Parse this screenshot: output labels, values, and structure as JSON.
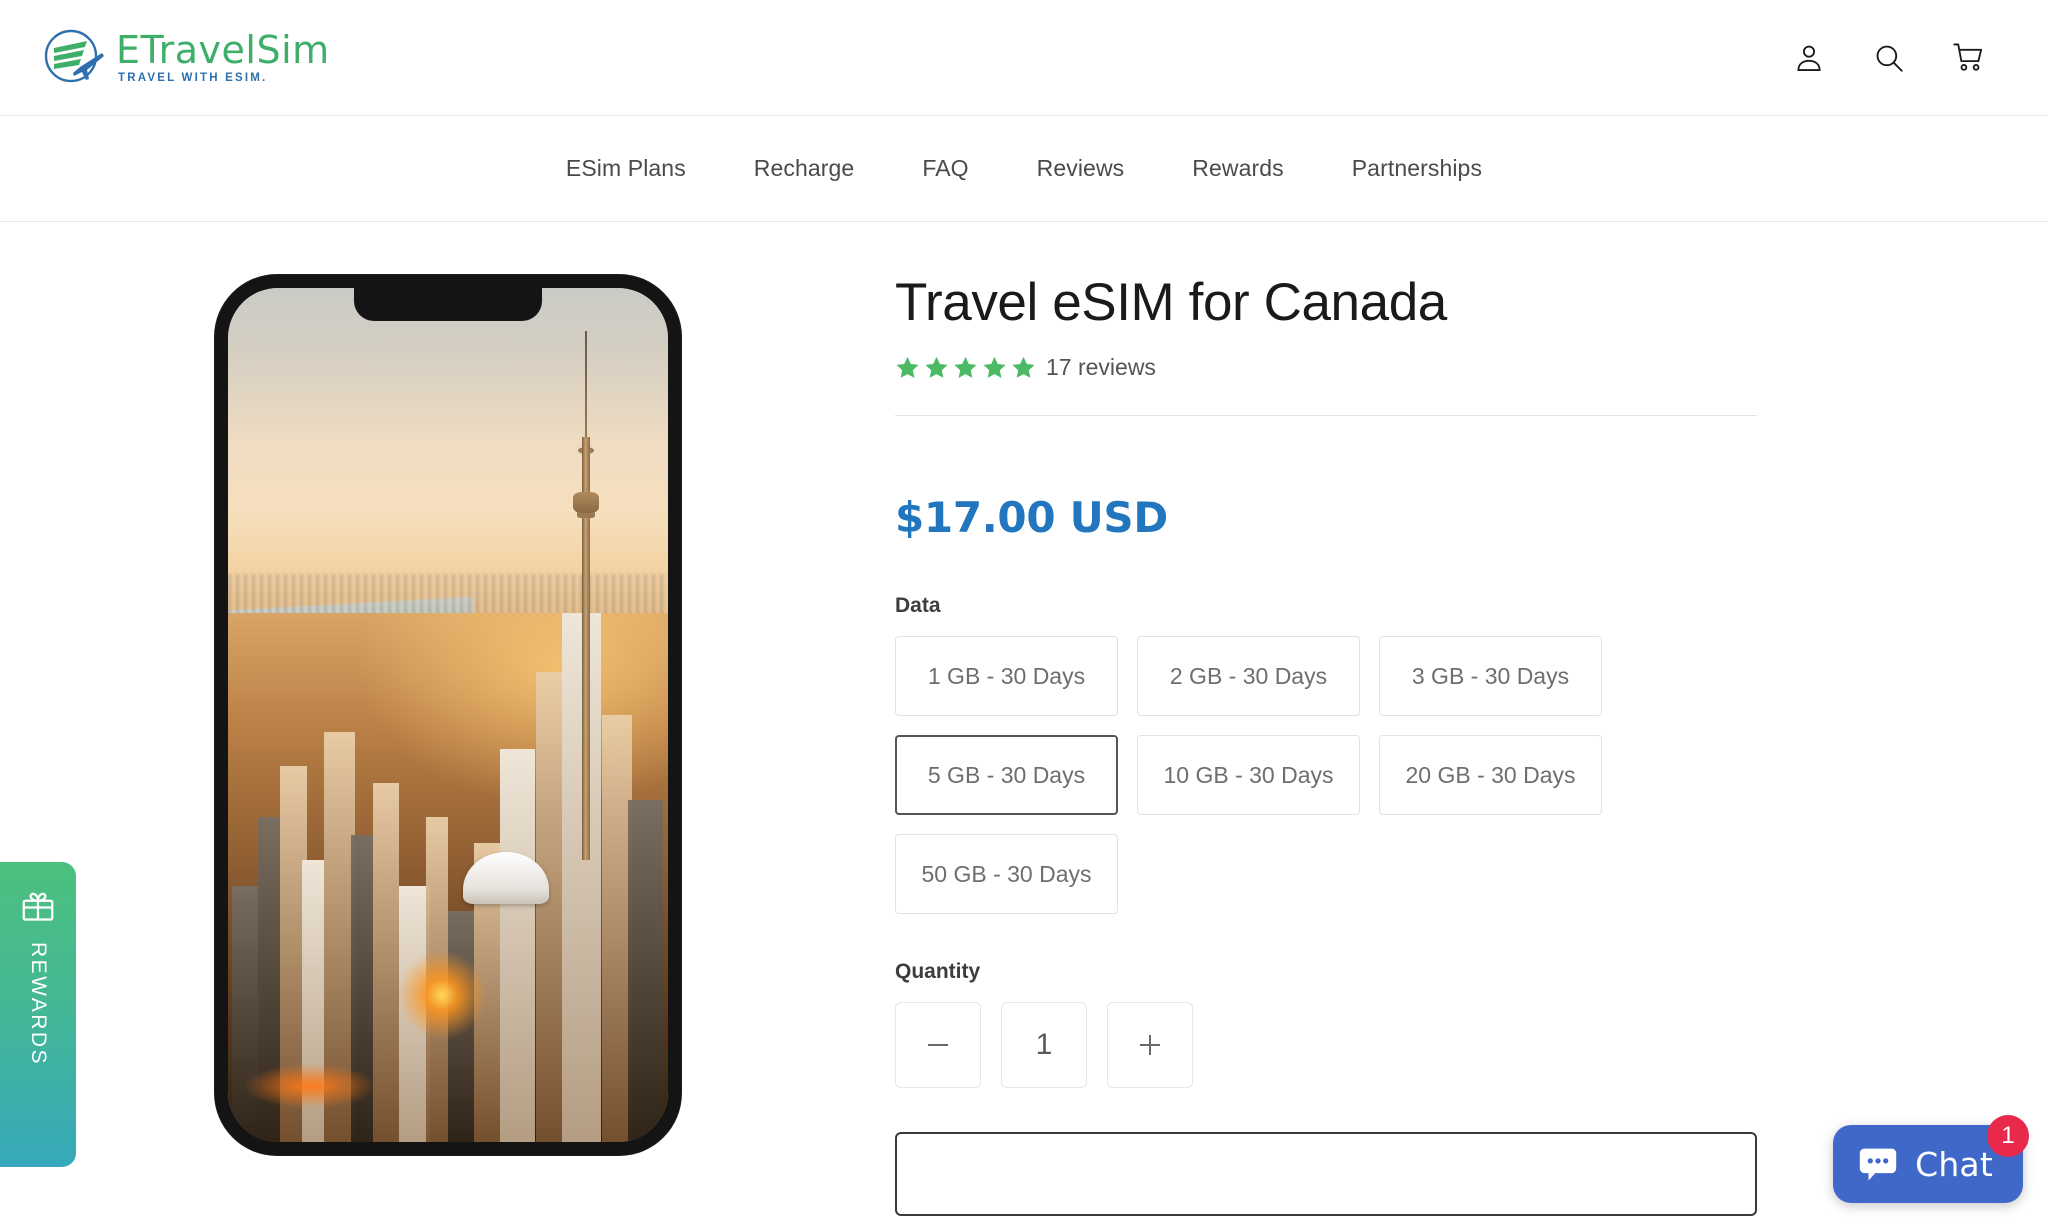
{
  "header": {
    "logo_name": "ETravelSim",
    "logo_tagline": "TRAVEL WITH ESIM.",
    "icons": [
      {
        "name": "account-icon",
        "label": "Account"
      },
      {
        "name": "search-icon",
        "label": "Search"
      },
      {
        "name": "cart-icon",
        "label": "Cart"
      }
    ]
  },
  "nav": {
    "items": [
      {
        "label": "ESim Plans"
      },
      {
        "label": "Recharge"
      },
      {
        "label": "FAQ"
      },
      {
        "label": "Reviews"
      },
      {
        "label": "Rewards"
      },
      {
        "label": "Partnerships"
      }
    ]
  },
  "product": {
    "title": "Travel eSIM for Canada",
    "rating_stars": 5,
    "review_count_label": "17 reviews",
    "price": "$17.00 USD",
    "price_color": "#2276bd",
    "star_color": "#4cb964",
    "data_label": "Data",
    "data_options": [
      {
        "label": "1 GB - 30 Days",
        "selected": false
      },
      {
        "label": "2 GB - 30 Days",
        "selected": false
      },
      {
        "label": "3 GB - 30 Days",
        "selected": false
      },
      {
        "label": "5 GB - 30 Days",
        "selected": true
      },
      {
        "label": "10 GB - 30 Days",
        "selected": false
      },
      {
        "label": "20 GB - 30 Days",
        "selected": false
      },
      {
        "label": "50 GB - 30 Days",
        "selected": false
      }
    ],
    "quantity_label": "Quantity",
    "quantity_value": "1",
    "quantity_decrease": "minus-icon",
    "quantity_increase": "plus-icon",
    "add_to_cart_label": ""
  },
  "gallery": {
    "image_alt": "Toronto skyline at sunset shown on a smartphone"
  },
  "rewards_tab": {
    "label": "REWARDS",
    "icon": "gift-icon",
    "gradient_from": "#4cc07e",
    "gradient_to": "#36a9bb"
  },
  "chat": {
    "label": "Chat",
    "badge_count": "1",
    "button_color": "#4068c8",
    "badge_color": "#e8294b"
  }
}
